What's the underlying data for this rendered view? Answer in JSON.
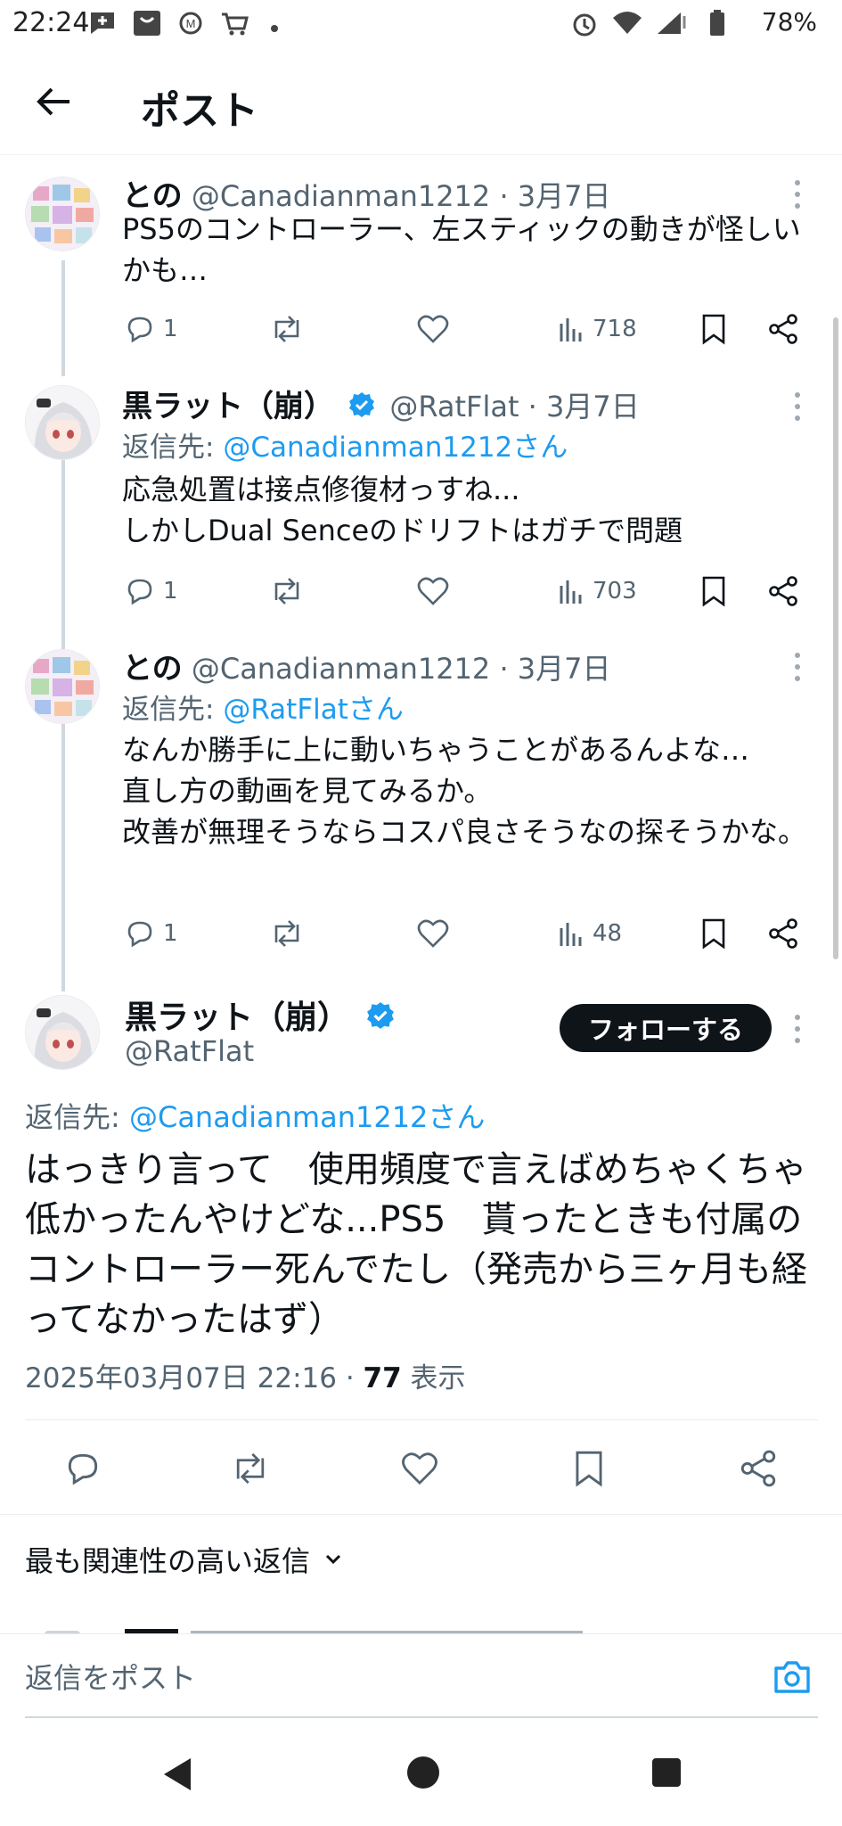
{
  "status_bar": {
    "time": "22:24",
    "battery": "78%",
    "icons": [
      "chat-plus-icon",
      "tray-icon",
      "m-icon",
      "cart-icon",
      "dot-icon",
      "alarm-icon",
      "wifi-icon",
      "signal-icon",
      "battery-icon"
    ]
  },
  "header": {
    "title": "ポスト"
  },
  "posts": [
    {
      "name": "との",
      "handle": "@Canadianman1212",
      "date": "· 3月7日",
      "reply_prefix": "",
      "reply_to": "",
      "text": "PS5のコントローラー、左スティックの動きが怪しいかも…",
      "replies": "1",
      "views": "718",
      "verified": false
    },
    {
      "name": "黒ラット（崩）",
      "handle": "@RatFlat",
      "date": "· 3月7日",
      "reply_prefix": "返信先: ",
      "reply_to": "@Canadianman1212さん",
      "text": "応急処置は接点修復材っすね...\nしかしDual Senceのドリフトはガチで問題",
      "replies": "1",
      "views": "703",
      "verified": true
    },
    {
      "name": "との",
      "handle": "@Canadianman1212",
      "date": "· 3月7日",
      "reply_prefix": "返信先: ",
      "reply_to": "@RatFlatさん",
      "text": "なんか勝手に上に動いちゃうことがあるんよな…\n直し方の動画を見てみるか。\n改善が無理そうならコスパ良さそうなの探そうかな。",
      "replies": "1",
      "views": "48",
      "verified": false
    }
  ],
  "focus_post": {
    "name": "黒ラット（崩）",
    "handle": "@RatFlat",
    "follow_label": "フォローする",
    "reply_prefix": "返信先: ",
    "reply_to": "@Canadianman1212さん",
    "text": "はっきり言って　使用頻度で言えばめちゃくちゃ低かったんやけどな...PS5　貰ったときも付属のコントローラー死んでたし（発売から三ヶ月も経ってなかったはず）",
    "timestamp": "2025年03月07日 22:16 · ",
    "views_count": "77",
    "views_label": " 表示"
  },
  "sort": {
    "label": "最も関連性の高い返信"
  },
  "composer": {
    "placeholder": "返信をポスト"
  },
  "colors": {
    "accent": "#1d9bf0",
    "text": "#0f1419",
    "muted": "#536471"
  }
}
